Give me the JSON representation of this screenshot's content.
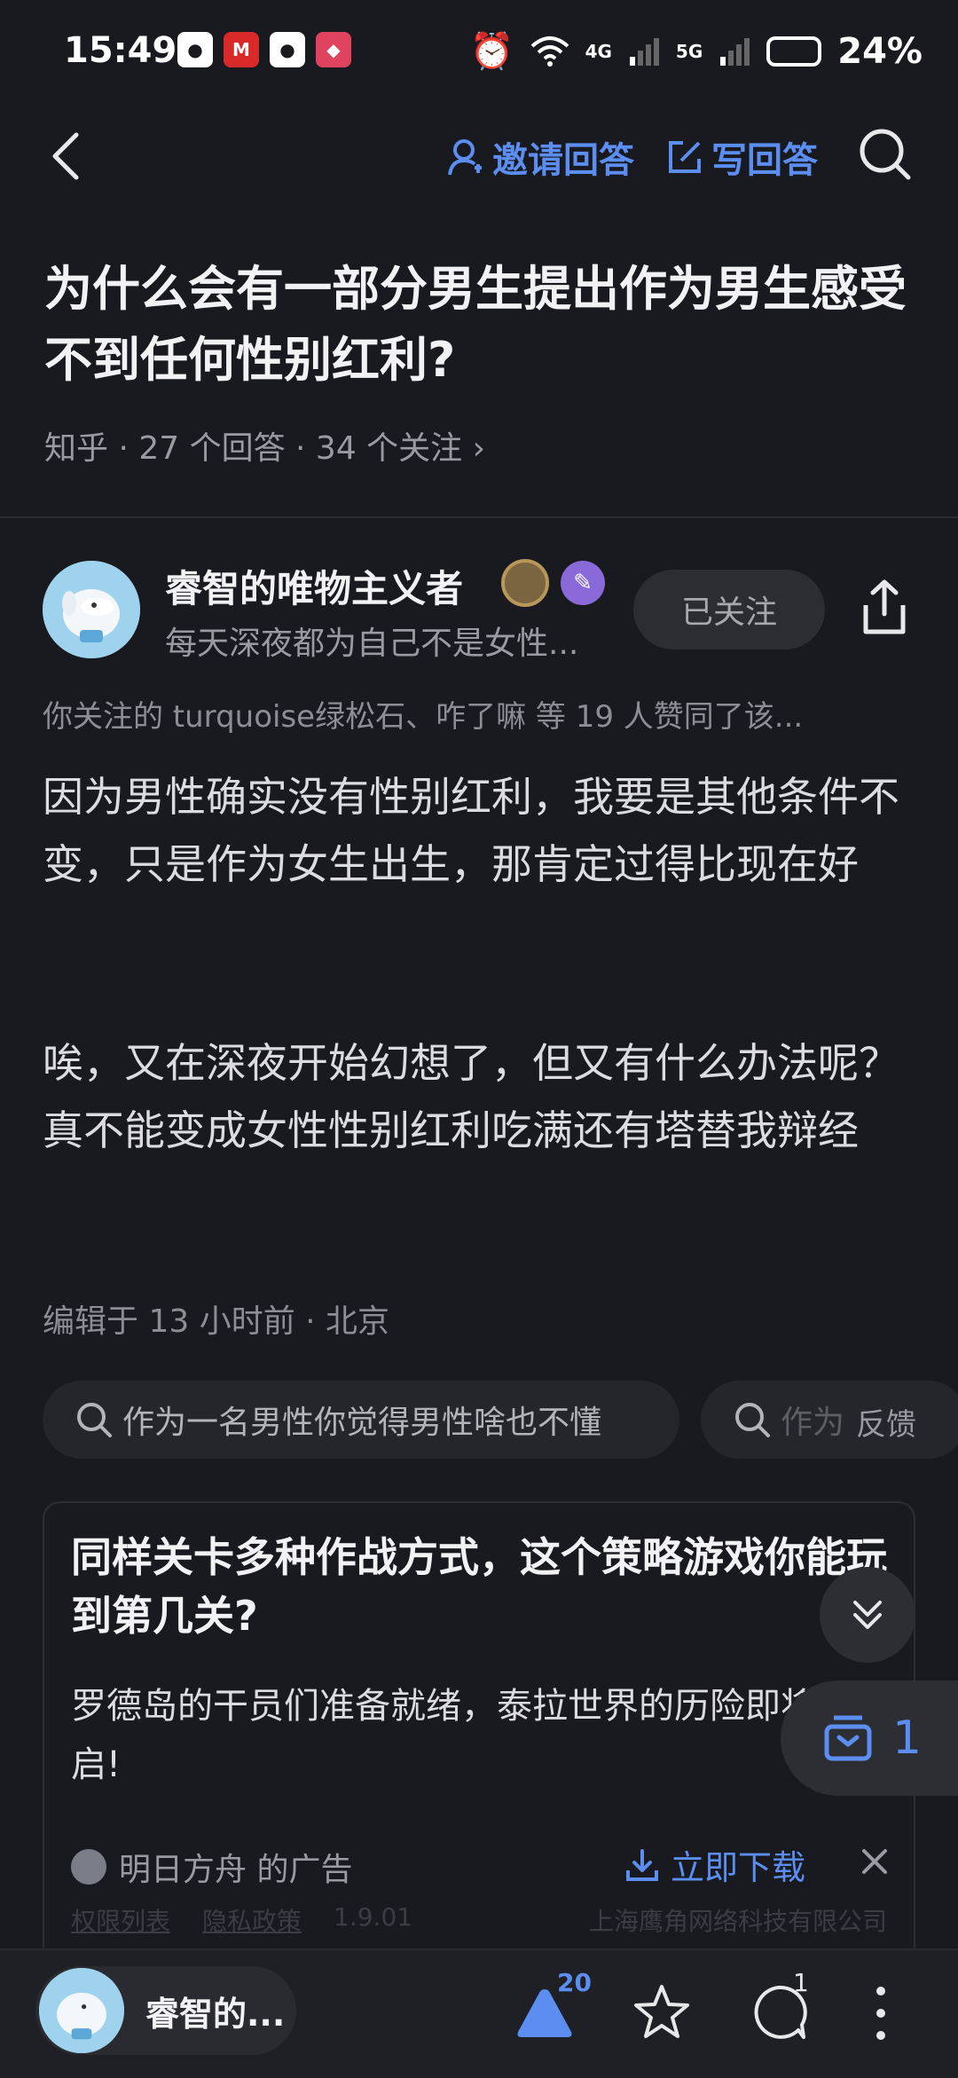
{
  "status_bar": {
    "time": "15:49",
    "network1": "4G",
    "network2": "5G",
    "battery": "24%"
  },
  "nav": {
    "invite_label": "邀请回答",
    "write_label": "写回答"
  },
  "question": {
    "title": "为什么会有一部分男生提出作为男生感受不到任何性别红利?",
    "meta": "知乎 · 27 个回答 · 34 个关注 ›"
  },
  "author": {
    "name": "睿智的唯物主义者",
    "bio": "每天深夜都为自己不是女性...",
    "follow_label": "已关注"
  },
  "answer": {
    "liked_by": "你关注的 turquoise绿松石、咋了嘛 等 19 人赞同了该...",
    "paragraphs": [
      "因为男性确实没有性别红利，我要是其他条件不变，只是作为女生出生，那肯定过得比现在好",
      "唉，又在深夜开始幻想了，但又有什么办法呢？真不能变成女性性别红利吃满还有塔替我辩经"
    ],
    "edited": "编辑于 13 小时前 · 北京"
  },
  "related": {
    "pill1": "作为一名男性你觉得男性啥也不懂",
    "pill2": "作为",
    "feedback": "反馈"
  },
  "ad": {
    "title": "同样关卡多种作战方式，这个策略游戏你能玩到第几关?",
    "desc": "罗德岛的干员们准备就绪，泰拉世界的历险即将开启!",
    "source": "明日方舟 的广告",
    "download_label": "立即下载",
    "legal_left1": "权限列表",
    "legal_left2": "隐私政策",
    "version": "1.9.01",
    "company": "上海鹰角网络科技有限公司"
  },
  "floating": {
    "favorites_count": "1"
  },
  "bottom": {
    "author_short": "睿智的...",
    "vote_count": "20",
    "comment_count": "1"
  },
  "colors": {
    "accent": "#5b8ef0",
    "background": "#191a1f"
  }
}
